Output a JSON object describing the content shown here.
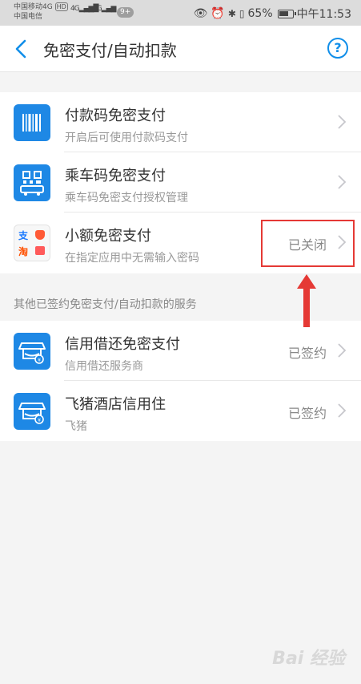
{
  "status_bar": {
    "carrier_1": "中国移动4G",
    "carrier_1_badge": "HD",
    "carrier_2": "中国电信",
    "net_1": "4G",
    "net_2": "2G",
    "notif_badge": "9+",
    "battery_pct": "65%",
    "time": "中午11:53"
  },
  "nav": {
    "title": "免密支付/自动扣款",
    "help_label": "?"
  },
  "group1": {
    "items": [
      {
        "title": "付款码免密支付",
        "subtitle": "开启后可使用付款码支付",
        "status": "",
        "icon": "barcode-icon"
      },
      {
        "title": "乘车码免密支付",
        "subtitle": "乘车码免密支付授权管理",
        "status": "",
        "icon": "bus-qr-icon"
      },
      {
        "title": "小额免密支付",
        "subtitle": "在指定应用中无需输入密码",
        "status": "已关闭",
        "icon": "alipay-taobao-icon"
      }
    ]
  },
  "section2": {
    "header": "其他已签约免密支付/自动扣款的服务",
    "items": [
      {
        "title": "信用借还免密支付",
        "subtitle": "信用借还服务商",
        "status": "已签约",
        "icon": "shop-icon"
      },
      {
        "title": "飞猪酒店信用住",
        "subtitle": "飞猪",
        "status": "已签约",
        "icon": "shop-icon"
      }
    ]
  },
  "mini_icons": {
    "alipay_char": "支",
    "taobao_char": "淘"
  },
  "colors": {
    "accent": "#108ee9",
    "icon_blue": "#1e88e5",
    "annotation_red": "#e53935"
  },
  "watermark": "Bai 经验"
}
